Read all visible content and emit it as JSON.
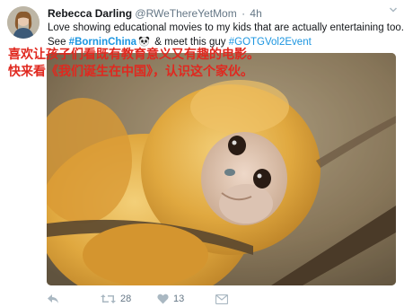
{
  "tweet": {
    "author_name": "Rebecca Darling",
    "handle": "@RWeThereYetMom",
    "separator": "·",
    "time": "4h",
    "text_line1": "Love showing educational movies to my kids that are actually entertaining too.",
    "text_line2_prefix": "See",
    "hashtag1": "#BorninChina",
    "text_line2_middle": "& meet this guy",
    "hashtag2": "#GOTGVol2Event",
    "retweet_count": "28",
    "like_count": "13"
  },
  "overlay_caption": {
    "line1": "喜欢让孩子们看既有教育意义又有趣的电影。",
    "line2": "快来看《我们诞生在中国》，认识这个家伙。"
  },
  "icons": {
    "avatar": "profile-photo",
    "menu": "chevron-down-icon",
    "reply": "reply-icon",
    "retweet": "retweet-icon",
    "like": "heart-icon",
    "message": "envelope-icon",
    "emoji": "panda-face-emoji"
  },
  "colors": {
    "link": "#1b95e0",
    "secondary_text": "#657786",
    "caption_red": "#e0281f"
  }
}
